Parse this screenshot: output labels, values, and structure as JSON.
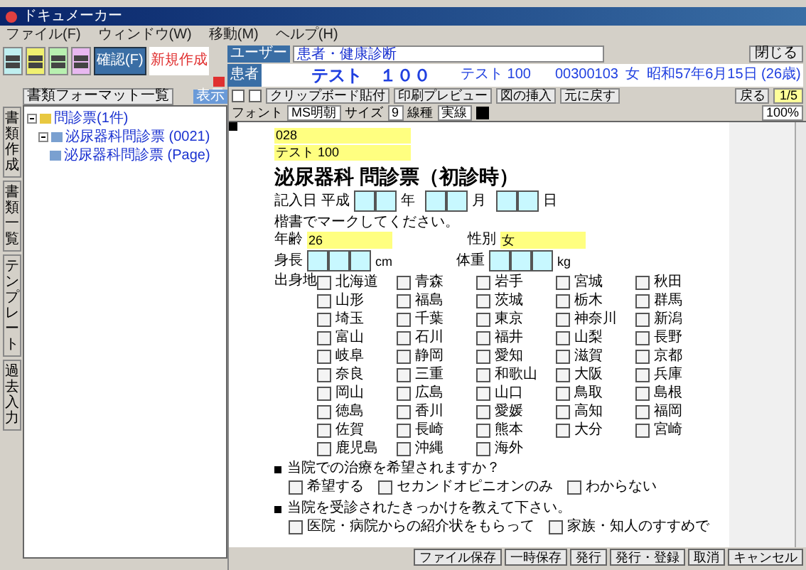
{
  "window": {
    "title": "ドキュメーカー"
  },
  "menu": [
    "ファイル(F)",
    "ウィンドウ(W)",
    "移動(M)",
    "ヘルプ(H)"
  ],
  "toolbar": {
    "buttons": [
      {
        "color": "#bfeff0"
      },
      {
        "color": "#f0f070"
      },
      {
        "color": "#b8f0b0"
      },
      {
        "color": "#e8b8f0"
      }
    ],
    "mode_button": "確認(F)",
    "new_document": "新規作成"
  },
  "left_panel": {
    "side_tabs": [
      "書類作成",
      "書類一覧",
      "テンプレート",
      "過去入力"
    ],
    "title": "書類フォーマット一覧",
    "view_button": "表示",
    "tree": [
      {
        "label": "問診票(1件)",
        "expanded": true,
        "children": [
          {
            "label": "泌尿器科問診票 (0021)",
            "expanded": true,
            "children": [
              {
                "label": "泌尿器科問診票 (Page)"
              }
            ]
          }
        ]
      }
    ]
  },
  "header": {
    "user_label": "ユーザー",
    "user_value": "患者・健康診断",
    "patient_label": "患者",
    "patient_name": "テスト　１００",
    "patient_kana": "テスト 100",
    "patient_number": "00300103",
    "sex": "女",
    "birth": "昭和57年6月15日 (26歳)",
    "close_button": "閉じる"
  },
  "tools": {
    "buttons": [
      "クリップボード貼付",
      "印刷プレビュー",
      "図の挿入",
      "元に戻す"
    ],
    "back_button": "戻る",
    "page": "1/5",
    "zoom": "100%"
  },
  "format_bar": [
    {
      "label": "フォント",
      "value": "MS明朝"
    },
    {
      "label": "サイズ",
      "value": "9"
    },
    {
      "label": "線種",
      "value": "実線"
    }
  ],
  "form": {
    "id_field": "028",
    "name_field": "テスト 100",
    "title": "泌尿器科 問診票（初診時）",
    "date_label": "記入日",
    "era": "平成",
    "date_units": [
      "年",
      "月",
      "日"
    ],
    "instruction": "楷書でマークしてください。",
    "age_label": "年齢",
    "age": "26",
    "sex_label": "性別",
    "sex": "女",
    "height_label": "身長",
    "height_unit": "cm",
    "weight_label": "体重",
    "weight_unit": "kg",
    "origin_label": "出身地",
    "prefectures": [
      {
        "label": "北海道",
        "checked": false
      },
      {
        "label": "青森",
        "checked": false
      },
      {
        "label": "岩手",
        "checked": false
      },
      {
        "label": "宮城",
        "checked": false
      },
      {
        "label": "秋田",
        "checked": false
      },
      {
        "label": "山形",
        "checked": false
      },
      {
        "label": "福島",
        "checked": false
      },
      {
        "label": "茨城",
        "checked": false
      },
      {
        "label": "栃木",
        "checked": false
      },
      {
        "label": "群馬",
        "checked": false
      },
      {
        "label": "埼玉",
        "checked": false
      },
      {
        "label": "千葉",
        "checked": false
      },
      {
        "label": "東京",
        "checked": false
      },
      {
        "label": "神奈川",
        "checked": false
      },
      {
        "label": "新潟",
        "checked": false
      },
      {
        "label": "富山",
        "checked": false
      },
      {
        "label": "石川",
        "checked": false
      },
      {
        "label": "福井",
        "checked": false
      },
      {
        "label": "山梨",
        "checked": false
      },
      {
        "label": "長野",
        "checked": false
      },
      {
        "label": "岐阜",
        "checked": false
      },
      {
        "label": "静岡",
        "checked": false
      },
      {
        "label": "愛知",
        "checked": false
      },
      {
        "label": "滋賀",
        "checked": false
      },
      {
        "label": "京都",
        "checked": false
      },
      {
        "label": "奈良",
        "checked": false
      },
      {
        "label": "三重",
        "checked": false
      },
      {
        "label": "和歌山",
        "checked": false
      },
      {
        "label": "大阪",
        "checked": false
      },
      {
        "label": "兵庫",
        "checked": false
      },
      {
        "label": "岡山",
        "checked": false
      },
      {
        "label": "広島",
        "checked": false
      },
      {
        "label": "山口",
        "checked": false
      },
      {
        "label": "鳥取",
        "checked": false
      },
      {
        "label": "島根",
        "checked": false
      },
      {
        "label": "徳島",
        "checked": false
      },
      {
        "label": "香川",
        "checked": false
      },
      {
        "label": "愛媛",
        "checked": false
      },
      {
        "label": "高知",
        "checked": false
      },
      {
        "label": "福岡",
        "checked": false
      },
      {
        "label": "佐賀",
        "checked": false
      },
      {
        "label": "長崎",
        "checked": false
      },
      {
        "label": "熊本",
        "checked": false
      },
      {
        "label": "大分",
        "checked": false
      },
      {
        "label": "宮崎",
        "checked": false
      },
      {
        "label": "鹿児島",
        "checked": false
      },
      {
        "label": "沖縄",
        "checked": false
      },
      {
        "label": "海外",
        "checked": false
      }
    ],
    "questions": [
      {
        "text": "当院での治療を希望されますか？",
        "options": [
          {
            "label": "希望する",
            "checked": false
          },
          {
            "label": "セカンドオピニオンのみ",
            "checked": false
          },
          {
            "label": "わからない",
            "checked": false
          }
        ]
      },
      {
        "text": "当院を受診されたきっかけを教えて下さい。",
        "options": [
          {
            "label": "医院・病院からの紹介状をもらって",
            "checked": false
          },
          {
            "label": "家族・知人のすすめで",
            "checked": false
          }
        ]
      }
    ]
  },
  "footer_buttons": [
    "ファイル保存",
    "一時保存",
    "発行",
    "発行・登録",
    "取消",
    "キャンセル"
  ]
}
